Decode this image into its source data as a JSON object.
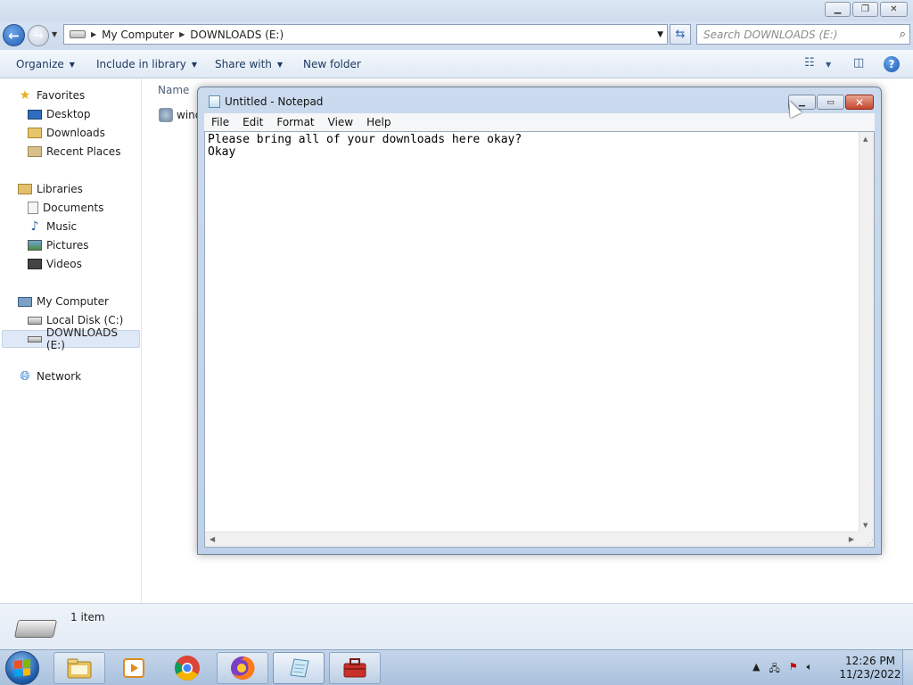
{
  "explorer": {
    "window_controls": [
      "minimize",
      "restore",
      "close"
    ],
    "address": {
      "crumbs": [
        "My Computer",
        "DOWNLOADS (E:)"
      ]
    },
    "search": {
      "placeholder": "Search DOWNLOADS (E:)"
    },
    "toolbar": {
      "organize": "Organize",
      "include_in_library": "Include in library",
      "share_with": "Share with",
      "new_folder": "New folder"
    },
    "nav": {
      "favorites": "Favorites",
      "favorites_items": [
        "Desktop",
        "Downloads",
        "Recent Places"
      ],
      "libraries": "Libraries",
      "libraries_items": [
        "Documents",
        "Music",
        "Pictures",
        "Videos"
      ],
      "my_computer": "My Computer",
      "my_computer_items": [
        "Local Disk (C:)",
        "DOWNLOADS (E:)"
      ],
      "network": "Network"
    },
    "columns": {
      "name": "Name"
    },
    "files": [
      {
        "name": "wind"
      }
    ],
    "status": {
      "count": "1 item"
    }
  },
  "notepad": {
    "title": "Untitled - Notepad",
    "menu": [
      "File",
      "Edit",
      "Format",
      "View",
      "Help"
    ],
    "text": "Please bring all of your downloads here okay?\nOkay"
  },
  "taskbar": {
    "apps": [
      "explorer",
      "media-player",
      "chrome",
      "firefox",
      "notepad",
      "toolbox"
    ],
    "clock": {
      "time": "12:26 PM",
      "date": "11/23/2022"
    }
  },
  "colors": {
    "accent": "#1d5caa",
    "close_red": "#c5452d",
    "selection": "#dfe8f6"
  }
}
